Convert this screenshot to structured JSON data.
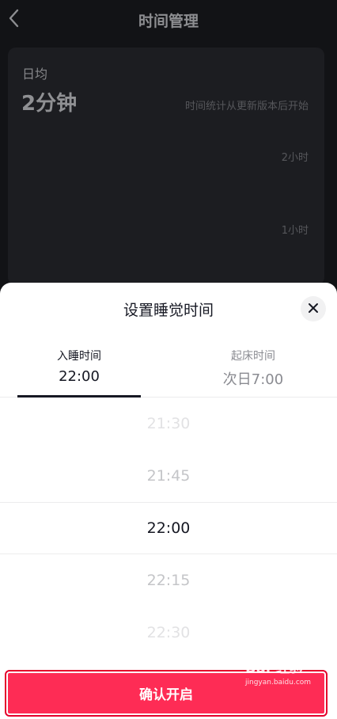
{
  "header": {
    "title": "时间管理"
  },
  "stats": {
    "avg_label": "日均",
    "avg_value": "2分钟",
    "note": "时间统计从更新版本后开始",
    "y_ticks": [
      "2小时",
      "1小时"
    ]
  },
  "sheet": {
    "title": "设置睡觉时间",
    "tabs": [
      {
        "label": "入睡时间",
        "value": "22:00",
        "active": true
      },
      {
        "label": "起床时间",
        "value": "次日7:00",
        "active": false
      }
    ],
    "picker": [
      "21:30",
      "21:45",
      "22:00",
      "22:15",
      "22:30"
    ],
    "selected": "22:00",
    "confirm_label": "确认开启"
  },
  "watermark": {
    "brand": "Bai 经验",
    "url": "jingyan.baidu.com"
  },
  "colors": {
    "accent": "#fe2c55",
    "sheet_bg": "#ffffff",
    "page_bg": "#121316"
  },
  "icons": {
    "back": "chevron-left-icon",
    "close": "close-icon",
    "watermark": "baidu-paw-icon"
  }
}
